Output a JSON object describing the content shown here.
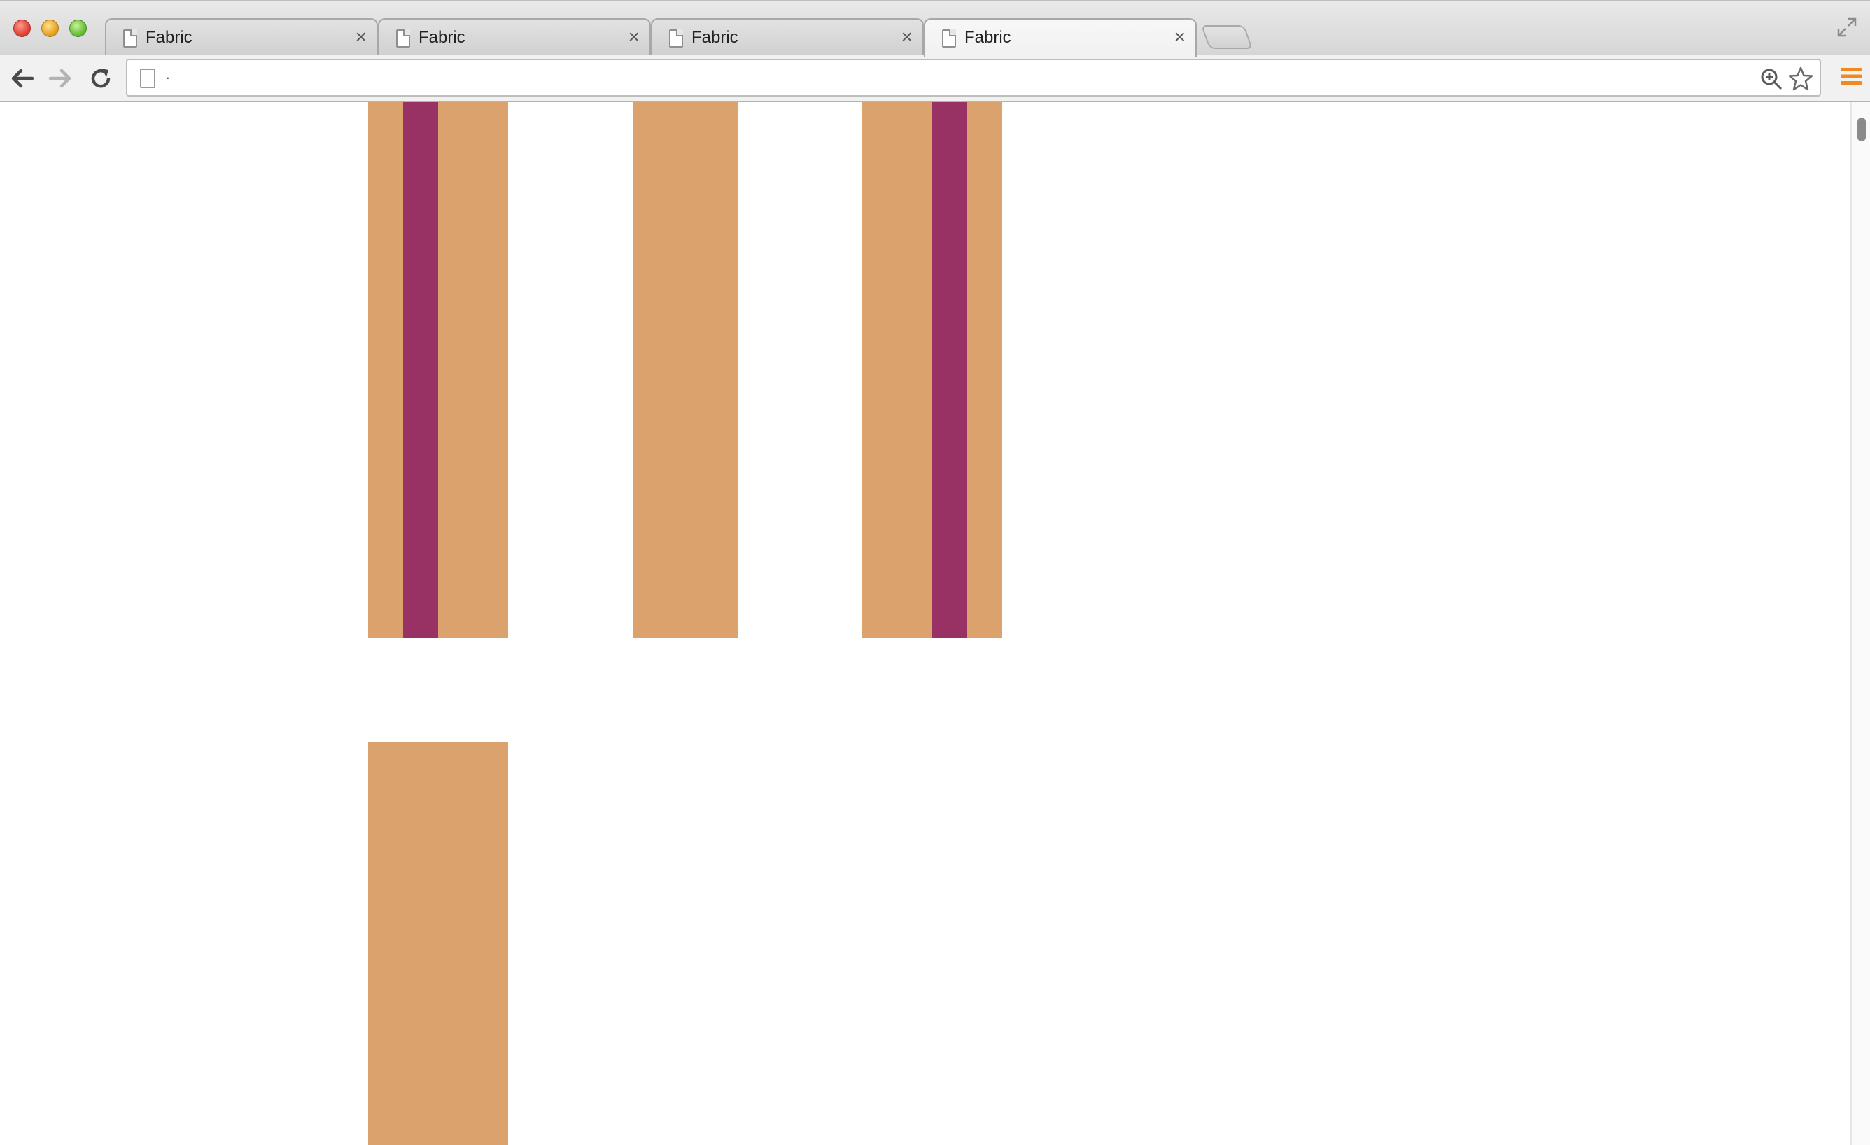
{
  "browser": {
    "tabs": [
      {
        "title": "Fabric",
        "active": false
      },
      {
        "title": "Fabric",
        "active": false
      },
      {
        "title": "Fabric",
        "active": false
      },
      {
        "title": "Fabric",
        "active": true
      }
    ],
    "tab_close_glyph": "×",
    "address_bar": {
      "url": "·"
    },
    "icons": {
      "back": "back-arrow-icon",
      "forward": "forward-arrow-icon",
      "reload": "reload-icon",
      "zoom": "zoom-icon",
      "bookmark": "star-icon",
      "menu": "hamburger-menu-icon",
      "fullscreen": "fullscreen-icon"
    }
  },
  "colors": {
    "fabric_base": "#dca26d",
    "fabric_stripe": "#983264",
    "menu_accent": "#f08a1e"
  }
}
